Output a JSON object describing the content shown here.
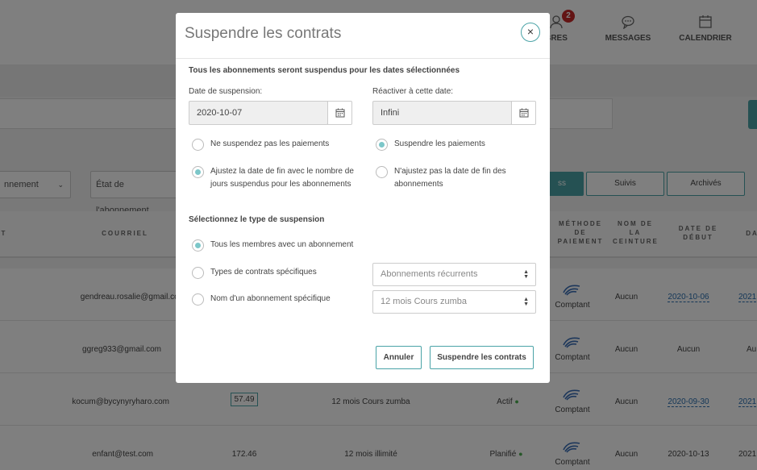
{
  "background": {
    "nav": [
      {
        "label": "BRES",
        "icon": "user-icon",
        "badge": "2"
      },
      {
        "label": "MESSAGES",
        "icon": "chat-icon"
      },
      {
        "label": "CALENDRIER",
        "icon": "calendar-icon"
      }
    ],
    "filters": {
      "filter1": "nnement",
      "filter2": "État de l'abonnement"
    },
    "segments": [
      "ss",
      "Suivis",
      "Archivés"
    ],
    "columns": [
      "T",
      "COURRIEL",
      "MÉTHODE DE PAIEMENT",
      "NOM DE LA CEINTURE",
      "DATE DE DÉBUT",
      "DA"
    ],
    "rows": [
      {
        "email": "gendreau.rosalie@gmail.com",
        "price": "",
        "plan": "",
        "status": "",
        "payment": "Comptant",
        "belt": "Aucun",
        "start": "2020-10-06",
        "end": "2021"
      },
      {
        "email": "ggreg933@gmail.com",
        "price": "",
        "plan": "",
        "status": "",
        "payment": "Comptant",
        "belt": "Aucun",
        "start": "Aucun",
        "end": "Au"
      },
      {
        "email": "kocum@bycynyryharo.com",
        "price": "57.49",
        "plan": "12 mois Cours zumba",
        "status": "Actif",
        "payment": "Comptant",
        "belt": "Aucun",
        "start": "2020-09-30",
        "end": "2021"
      },
      {
        "email": "enfant@test.com",
        "price": "172.46",
        "plan": "12 mois illimité",
        "status": "Planifié",
        "payment": "Comptant",
        "belt": "Aucun",
        "start": "2020-10-13",
        "end": "2021"
      }
    ]
  },
  "modal": {
    "title": "Suspendre les contrats",
    "close_symbol": "×",
    "intro": "Tous les abonnements seront suspendus pour les dates sélectionnées",
    "suspension_date_label": "Date de suspension:",
    "suspension_date_value": "2020-10-07",
    "reactivate_label": "Réactiver à cette date:",
    "reactivate_value": "Infini",
    "options": {
      "no_suspend_payments": "Ne suspendez pas les paiements",
      "suspend_payments": "Suspendre les paiements",
      "adjust_end_date": "Ajustez la date de fin avec le nombre de jours suspendus pour les abonnements",
      "no_adjust_end_date": "N'ajustez pas la date de fin des abonnements"
    },
    "type_title": "Sélectionnez le type de suspension",
    "types": {
      "all_members": "Tous les membres avec un abonnement",
      "specific_contract_types": "Types de contrats spécifiques",
      "specific_subscription": "Nom d'un abonnement spécifique"
    },
    "contract_type_select": "Abonnements récurrents",
    "subscription_select": "12 mois Cours zumba",
    "cancel_label": "Annuler",
    "submit_label": "Suspendre les contrats"
  }
}
